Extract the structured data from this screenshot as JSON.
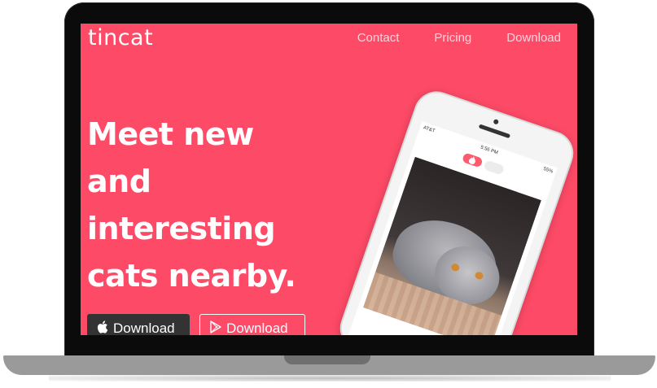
{
  "site": {
    "brand": "tincat",
    "nav": [
      "Contact",
      "Pricing",
      "Download"
    ],
    "headline": [
      "Meet new",
      "and",
      "interesting",
      "cats nearby."
    ],
    "buttons": {
      "apple_label": "Download",
      "play_label": "Download"
    }
  },
  "phone": {
    "carrier": "AT&T",
    "time": "5:56 PM",
    "battery": "55%"
  },
  "colors": {
    "accent": "#fd4a67",
    "dark_button": "#333333",
    "text": "#ffffff"
  }
}
